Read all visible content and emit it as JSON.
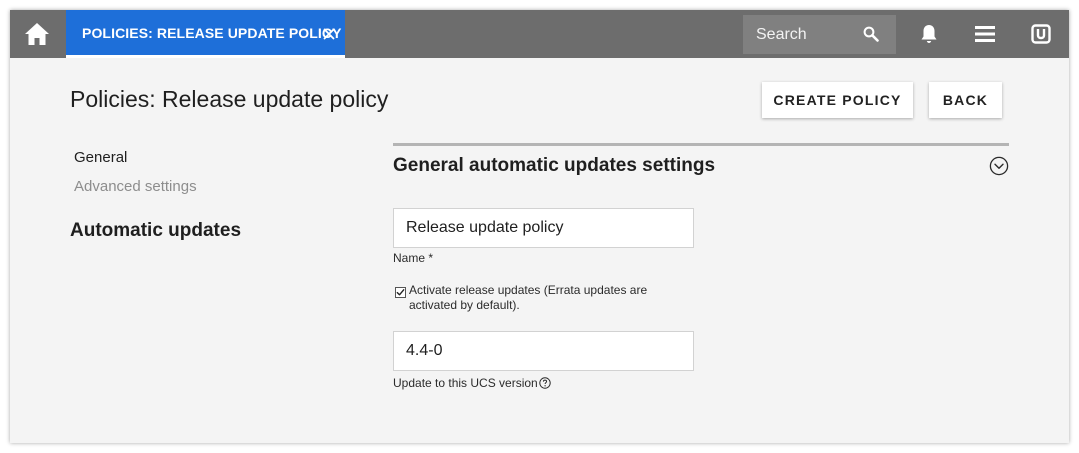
{
  "topbar": {
    "tab_label": "POLICIES: RELEASE UPDATE POLICY",
    "search_placeholder": "Search",
    "icons": [
      "home-icon",
      "close-icon",
      "search-icon",
      "bell-icon",
      "menu-icon",
      "univention-logo-icon"
    ]
  },
  "page": {
    "title": "Policies: Release update policy",
    "create_label": "CREATE POLICY",
    "back_label": "BACK"
  },
  "nav": {
    "items": [
      {
        "label": "General",
        "active": true
      },
      {
        "label": "Advanced settings",
        "active": false
      }
    ],
    "heading": "Automatic updates"
  },
  "section": {
    "title": "General automatic updates settings",
    "name_value": "Release update policy",
    "name_label": "Name *",
    "activate_checked": true,
    "activate_label": "Activate release updates (Errata updates are activated by default).",
    "version_value": "4.4-0",
    "version_label": "Update to this UCS version"
  },
  "colors": {
    "topbar": "#6d6d6d",
    "tab_active": "#1e6fd9",
    "background": "#f4f4f4"
  }
}
